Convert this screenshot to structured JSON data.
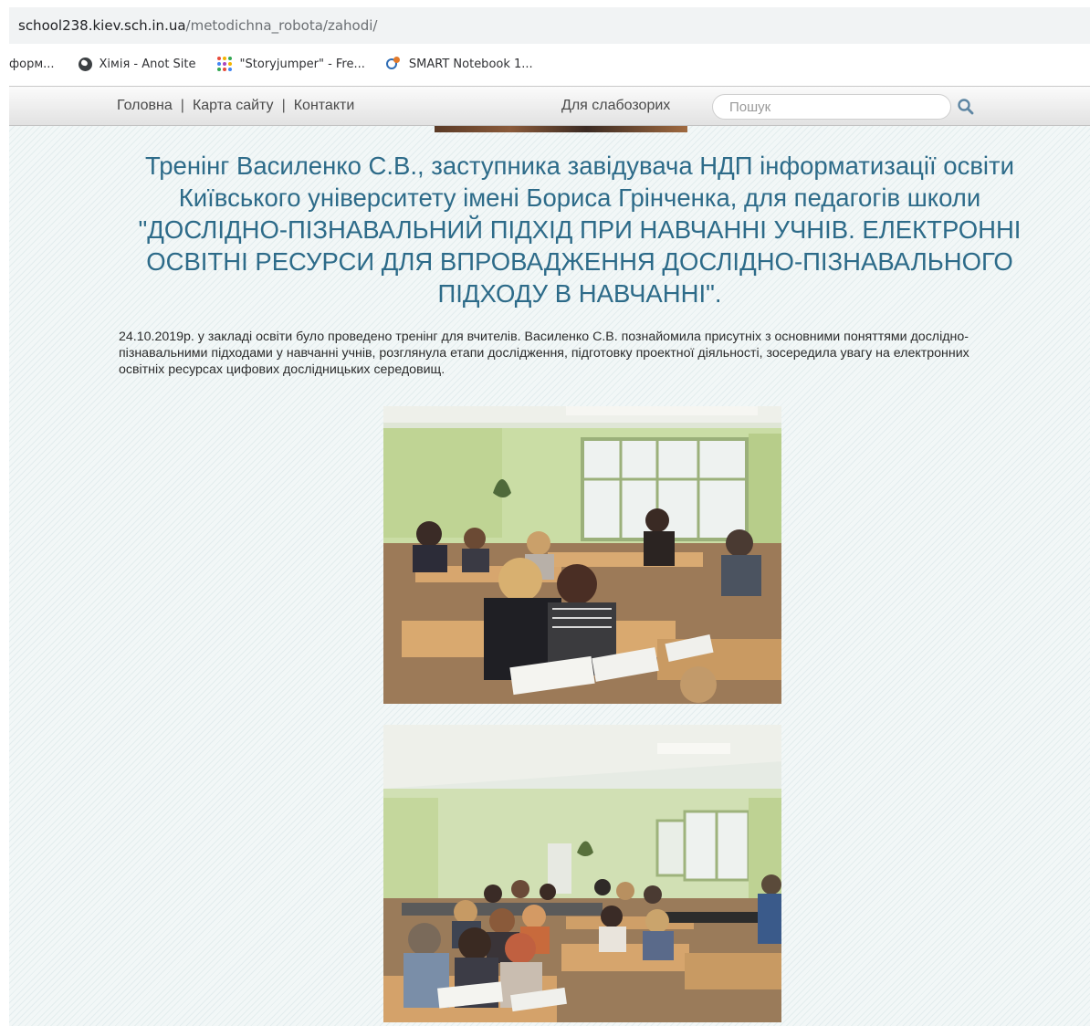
{
  "browser": {
    "url_domain": "school238.kiev.sch.in.ua",
    "url_path": "/metodichna_robota/zahodi/",
    "bookmarks": [
      {
        "label": "форм...",
        "icon": "none"
      },
      {
        "label": "Хімія - Anot Site",
        "icon": "globe-icon"
      },
      {
        "label": "\"Storyjumper\" - Fre...",
        "icon": "dots-grid-icon"
      },
      {
        "label": "SMART Notebook 1...",
        "icon": "smart-notebook-icon"
      }
    ]
  },
  "site": {
    "nav": {
      "home": "Головна",
      "sitemap": "Карта сайту",
      "contacts": "Контакти",
      "separator": "|",
      "low_vision": "Для слабозорих"
    },
    "search": {
      "placeholder": "Пошук",
      "icon": "search-icon"
    }
  },
  "article": {
    "title": "Тренінг Василенко С.В., заступника завідувача НДП інформатизації освіти Київського університету імені Бориса Грінченка, для педагогів школи \"ДОСЛІДНО-ПІЗНАВАЛЬНИЙ ПІДХІД ПРИ НАВЧАННІ УЧНІВ. ЕЛЕКТРОННІ ОСВІТНІ РЕСУРСИ ДЛЯ ВПРОВАДЖЕННЯ ДОСЛІДНО-ПІЗНАВАЛЬНОГО ПІДХОДУ В НАВЧАННІ\".",
    "body": "24.10.2019р. у закладі освіти було проведено тренінг для вчителів. Василенко С.В. познайомила присутніх з основними поняттями дослідно-пізнавальними підходами у навчанні учнів, розглянула етапи дослідження, підготовку проектної діяльності, зосередила увагу на електронних освітніх ресурсах цифових дослідницьких середовищ."
  },
  "colors": {
    "title": "#2d6b89",
    "wall_green": "#c9dca3",
    "url_path_gray": "#6b6f73"
  }
}
